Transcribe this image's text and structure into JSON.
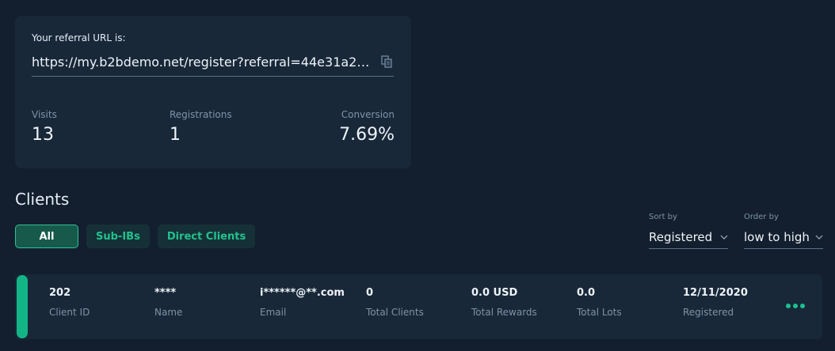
{
  "referral": {
    "label": "Your referral URL is:",
    "url": "https://my.b2bdemo.net/register?referral=44e31a2…"
  },
  "stats": [
    {
      "label": "Visits",
      "value": "13"
    },
    {
      "label": "Registrations",
      "value": "1"
    },
    {
      "label": "Conversion",
      "value": "7.69%"
    }
  ],
  "clients": {
    "title": "Clients",
    "tabs": [
      "All",
      "Sub-IBs",
      "Direct Clients"
    ],
    "active_tab": "All",
    "sort_by": {
      "label": "Sort by",
      "value": "Registered"
    },
    "order_by": {
      "label": "Order by",
      "value": "low to high"
    },
    "rows": [
      {
        "cells": [
          {
            "value": "202",
            "label": "Client ID"
          },
          {
            "value": "****",
            "label": "Name"
          },
          {
            "value": "i******@**.com",
            "label": "Email"
          },
          {
            "value": "0",
            "label": "Total Clients"
          },
          {
            "value": "0.0 USD",
            "label": "Total Rewards"
          },
          {
            "value": "0.0",
            "label": "Total Lots"
          },
          {
            "value": "12/11/2020",
            "label": "Registered"
          }
        ]
      }
    ]
  },
  "icons": {
    "copy": "copy-icon",
    "chevron": "chevron-down-icon",
    "more": "more-horizontal-icon"
  },
  "colors": {
    "background": "#131f2e",
    "card": "#182839",
    "accent": "#1ac08e",
    "tab_bg": "#163038"
  }
}
